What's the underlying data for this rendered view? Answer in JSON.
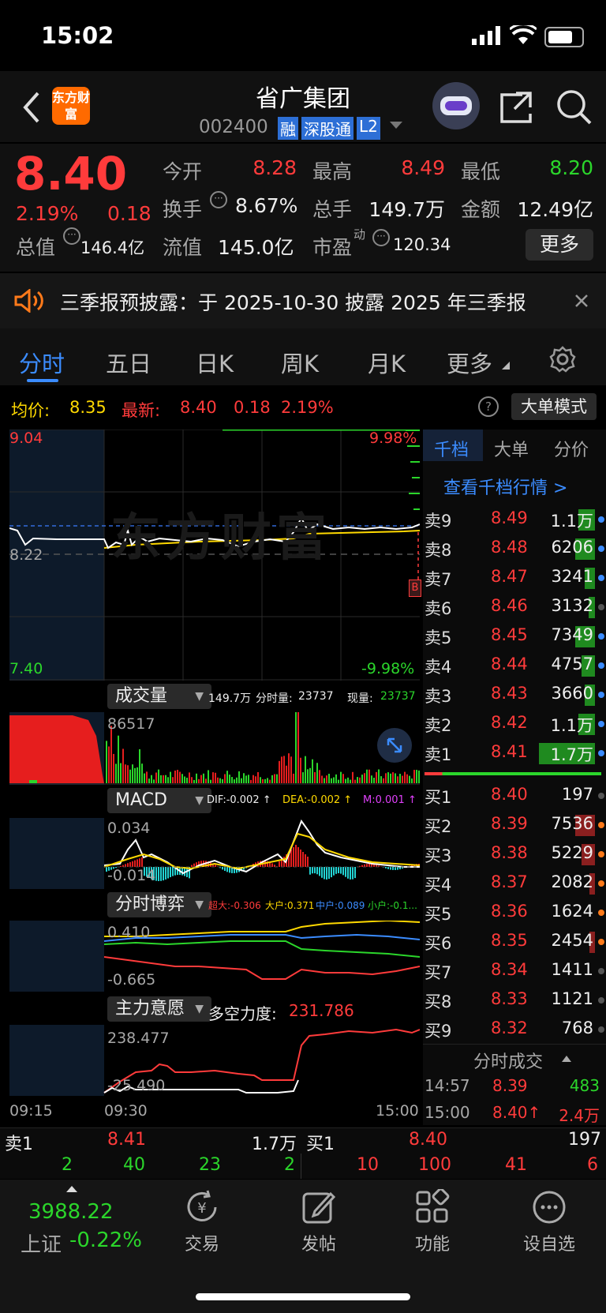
{
  "status": {
    "time": "15:02"
  },
  "header": {
    "title": "省广集团",
    "code": "002400",
    "badges": [
      "融",
      "深股通",
      "L2"
    ],
    "logo_text": "东方财富"
  },
  "quote": {
    "price": "8.40",
    "pct": "2.19%",
    "change": "0.18",
    "fields": [
      {
        "label": "今开",
        "value": "8.28"
      },
      {
        "label": "最高",
        "value": "8.49"
      },
      {
        "label": "最低",
        "value": "8.20"
      },
      {
        "label": "换手",
        "value": "8.67%"
      },
      {
        "label": "总手",
        "value": "149.7万"
      },
      {
        "label": "金额",
        "value": "12.49亿"
      },
      {
        "label": "总值",
        "value": "146.4亿"
      },
      {
        "label": "流值",
        "value": "145.0亿"
      },
      {
        "label": "市盈",
        "sup": "动",
        "value": "120.34"
      }
    ],
    "more_label": "更多"
  },
  "notice": {
    "text": "三季报预披露：于 2025-10-30 披露 2025 年三季报"
  },
  "tabs": [
    "分时",
    "五日",
    "日K",
    "周K",
    "月K",
    "更多"
  ],
  "info": {
    "avg_label": "均价:",
    "avg_value": "8.35",
    "latest_label": "最新:",
    "latest_value": "8.40",
    "latest_change": "0.18",
    "latest_pct": "2.19%",
    "mode_label": "大单模式"
  },
  "chart": {
    "y_top": "9.04",
    "y_mid": "8.22",
    "y_bottom": "7.40",
    "pct_top": "9.98%",
    "pct_bottom": "-9.98%",
    "watermark": "东方财富",
    "marker": "B"
  },
  "volume": {
    "label": "成交量",
    "summary_total": "149.7万",
    "summary_fs_label": "分时量:",
    "summary_fs": "23737",
    "summary_now_label": "现量:",
    "summary_now": "23737",
    "axis_max": "86517"
  },
  "macd": {
    "label": "MACD",
    "dif": "DIF:-0.002 ↑",
    "dea": "DEA:-0.002 ↑",
    "m": "M:0.001 ↑",
    "axis_top": "0.034",
    "axis_bottom": "-0.014"
  },
  "fsbo": {
    "label": "分时博弈",
    "chaoda": "超大:-0.306",
    "dahu": "大户:0.371",
    "zhonghu": "中户:0.089",
    "xiaohu": "小户:-0.1...",
    "axis_top": "0.410",
    "axis_bottom": "-0.665"
  },
  "zlyy": {
    "label": "主力意愿",
    "force_label": "多空力度:",
    "force_value": "231.786",
    "axis_top": "238.477",
    "axis_bottom": "-25.490"
  },
  "time_axis": [
    "09:15",
    "09:30",
    "15:00"
  ],
  "orderbook": {
    "tabs": [
      "千档",
      "大单",
      "分价"
    ],
    "link": "查看千档行情 >",
    "asks": [
      {
        "label": "卖9",
        "price": "8.49",
        "vol": "1.1万",
        "fill": 0.25
      },
      {
        "label": "卖8",
        "price": "8.48",
        "vol": "6206",
        "fill": 0.3
      },
      {
        "label": "卖7",
        "price": "8.47",
        "vol": "3241",
        "fill": 0.15
      },
      {
        "label": "卖6",
        "price": "8.46",
        "vol": "3132",
        "fill": 0.1
      },
      {
        "label": "卖5",
        "price": "8.45",
        "vol": "7349",
        "fill": 0.3
      },
      {
        "label": "卖4",
        "price": "8.44",
        "vol": "4757",
        "fill": 0.2
      },
      {
        "label": "卖3",
        "price": "8.43",
        "vol": "3660",
        "fill": 0.15
      },
      {
        "label": "卖2",
        "price": "8.42",
        "vol": "1.1万",
        "fill": 0.25
      },
      {
        "label": "卖1",
        "price": "8.41",
        "vol": "1.7万",
        "fill": 0.85
      }
    ],
    "bids": [
      {
        "label": "买1",
        "price": "8.40",
        "vol": "197",
        "fill": 0
      },
      {
        "label": "买2",
        "price": "8.39",
        "vol": "7536",
        "fill": 0.3
      },
      {
        "label": "买3",
        "price": "8.38",
        "vol": "5229",
        "fill": 0.2
      },
      {
        "label": "买4",
        "price": "8.37",
        "vol": "2082",
        "fill": 0.08
      },
      {
        "label": "买5",
        "price": "8.36",
        "vol": "1624",
        "fill": 0
      },
      {
        "label": "买6",
        "price": "8.35",
        "vol": "2454",
        "fill": 0.08
      },
      {
        "label": "买7",
        "price": "8.34",
        "vol": "1411",
        "fill": 0
      },
      {
        "label": "买8",
        "price": "8.33",
        "vol": "1121",
        "fill": 0
      },
      {
        "label": "买9",
        "price": "8.32",
        "vol": "768",
        "fill": 0
      }
    ],
    "ticks_label": "分时成交",
    "ticks": [
      {
        "time": "14:57",
        "price": "8.39",
        "vol": "483"
      },
      {
        "time": "15:00",
        "price": "8.40↑",
        "vol": "2.4万"
      }
    ]
  },
  "bottom_bar": {
    "ask_label": "卖1",
    "ask_price": "8.41",
    "ask_vol": "1.7万",
    "bid_label": "买1",
    "bid_price": "8.40",
    "bid_vol": "197",
    "left_nums": [
      "2",
      "40",
      "23",
      "2"
    ],
    "right_nums": [
      "10",
      "100",
      "41",
      "6"
    ]
  },
  "bottom_nav": {
    "index_value": "3988.22",
    "index_name": "上证",
    "index_pct": "-0.22%",
    "items": [
      "交易",
      "发帖",
      "功能",
      "设自选"
    ]
  }
}
